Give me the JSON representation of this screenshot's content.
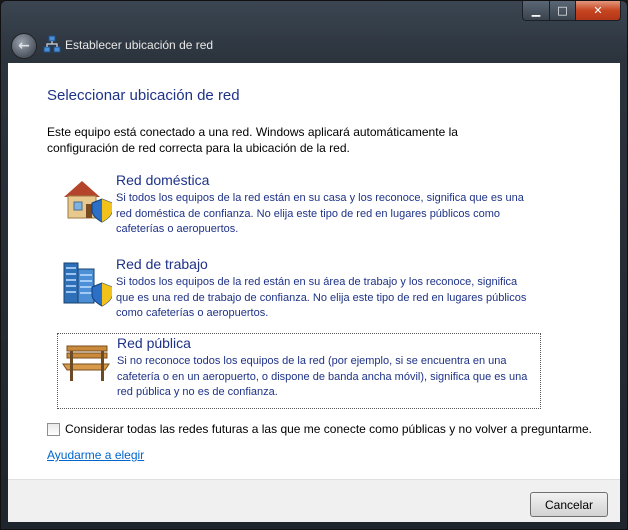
{
  "window": {
    "title": "Establecer ubicación de red"
  },
  "controls": {
    "minimize": "▁",
    "maximize": "□",
    "close": "✕"
  },
  "content": {
    "heading": "Seleccionar ubicación de red",
    "intro": "Este equipo está conectado a una red. Windows aplicará automáticamente la configuración de red correcta para la ubicación de la red.",
    "options": [
      {
        "title": "Red doméstica",
        "icon": "house-shield-icon",
        "description": "Si todos los equipos de la red están en su casa y los reconoce, significa que es una red doméstica de confianza. No elija este tipo de red en lugares públicos como cafeterías o aeropuertos."
      },
      {
        "title": "Red de trabajo",
        "icon": "office-building-shield-icon",
        "description": "Si todos los equipos de la red están en su área de trabajo y los reconoce, significa que es una red de trabajo de confianza. No elija este tipo de red en lugares públicos como cafeterías o aeropuertos."
      },
      {
        "title": "Red pública",
        "icon": "park-bench-icon",
        "description": "Si no reconoce todos los equipos de la red (por ejemplo, si se encuentra en una cafetería o en un aeropuerto, o dispone de banda ancha móvil), significa que es una red pública y no es de confianza."
      }
    ],
    "checkbox_label": "Considerar todas las redes futuras a las que me conecte como públicas y no volver a preguntarme.",
    "help_link": "Ayudarme a elegir"
  },
  "footer": {
    "cancel_label": "Cancelar"
  }
}
